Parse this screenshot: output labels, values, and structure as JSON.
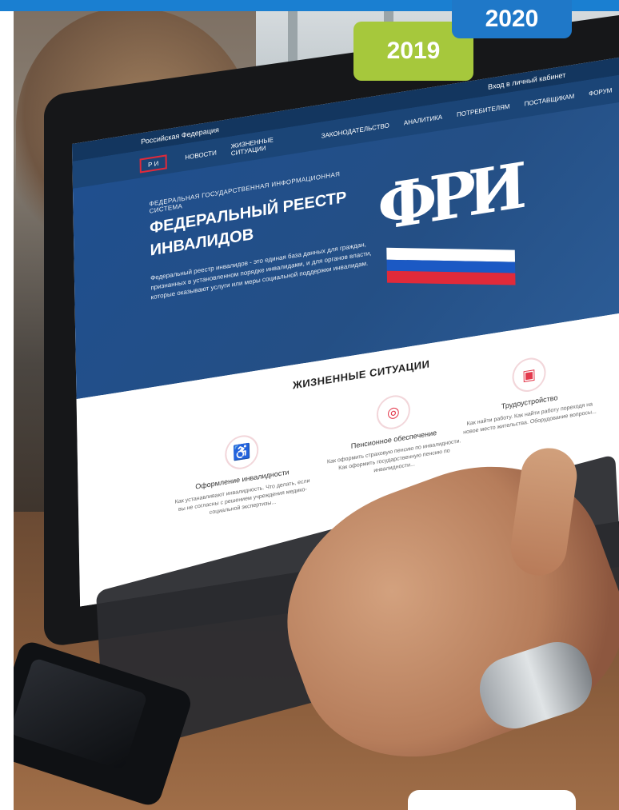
{
  "years": {
    "year_2020": "2020",
    "year_2019": "2019"
  },
  "site": {
    "region_selector": "Российская Федерация",
    "login": "Вход в личный кабинет",
    "logo_small": "Р И",
    "nav": [
      "НОВОСТИ",
      "ЖИЗНЕННЫЕ СИТУАЦИИ",
      "ЗАКОНОДАТЕЛЬСТВО",
      "АНАЛИТИКА",
      "ПОТРЕБИТЕЛЯМ",
      "ПОСТАВЩИКАМ",
      "ФОРУМ"
    ],
    "hero": {
      "subtitle": "ФЕДЕРАЛЬНАЯ ГОСУДАРСТВЕННАЯ ИНФОРМАЦИОННАЯ СИСТЕМА",
      "title_line1": "ФЕДЕРАЛЬНЫЙ РЕЕСТР",
      "title_line2": "ИНВАЛИДОВ",
      "description": "Федеральный реестр инвалидов - это единая база данных для граждан, признанных в установленном порядке инвалидами, и для органов власти, которые оказывают услуги или меры социальной поддержки инвалидам.",
      "big_logo": "ФРИ"
    },
    "section": {
      "title": "ЖИЗНЕННЫЕ СИТУАЦИИ",
      "cards": [
        {
          "title": "Оформление инвалидности",
          "description": "Как устанавливают инвалидность. Что делать, если вы не согласны с решением учреждения медико-социальной экспертизы..."
        },
        {
          "title": "Пенсионное обеспечение",
          "description": "Как оформить страховую пенсию по инвалидности. Как оформить государственную пенсию по инвалидности..."
        },
        {
          "title": "Трудоустройство",
          "description": "Как найти работу. Как найти работу пореходя на новое место жительства. Оборудование вопросы..."
        }
      ]
    }
  },
  "colors": {
    "accent_blue": "#1f78c8",
    "accent_green": "#a6c83c",
    "accent_red": "#e33a4d"
  }
}
